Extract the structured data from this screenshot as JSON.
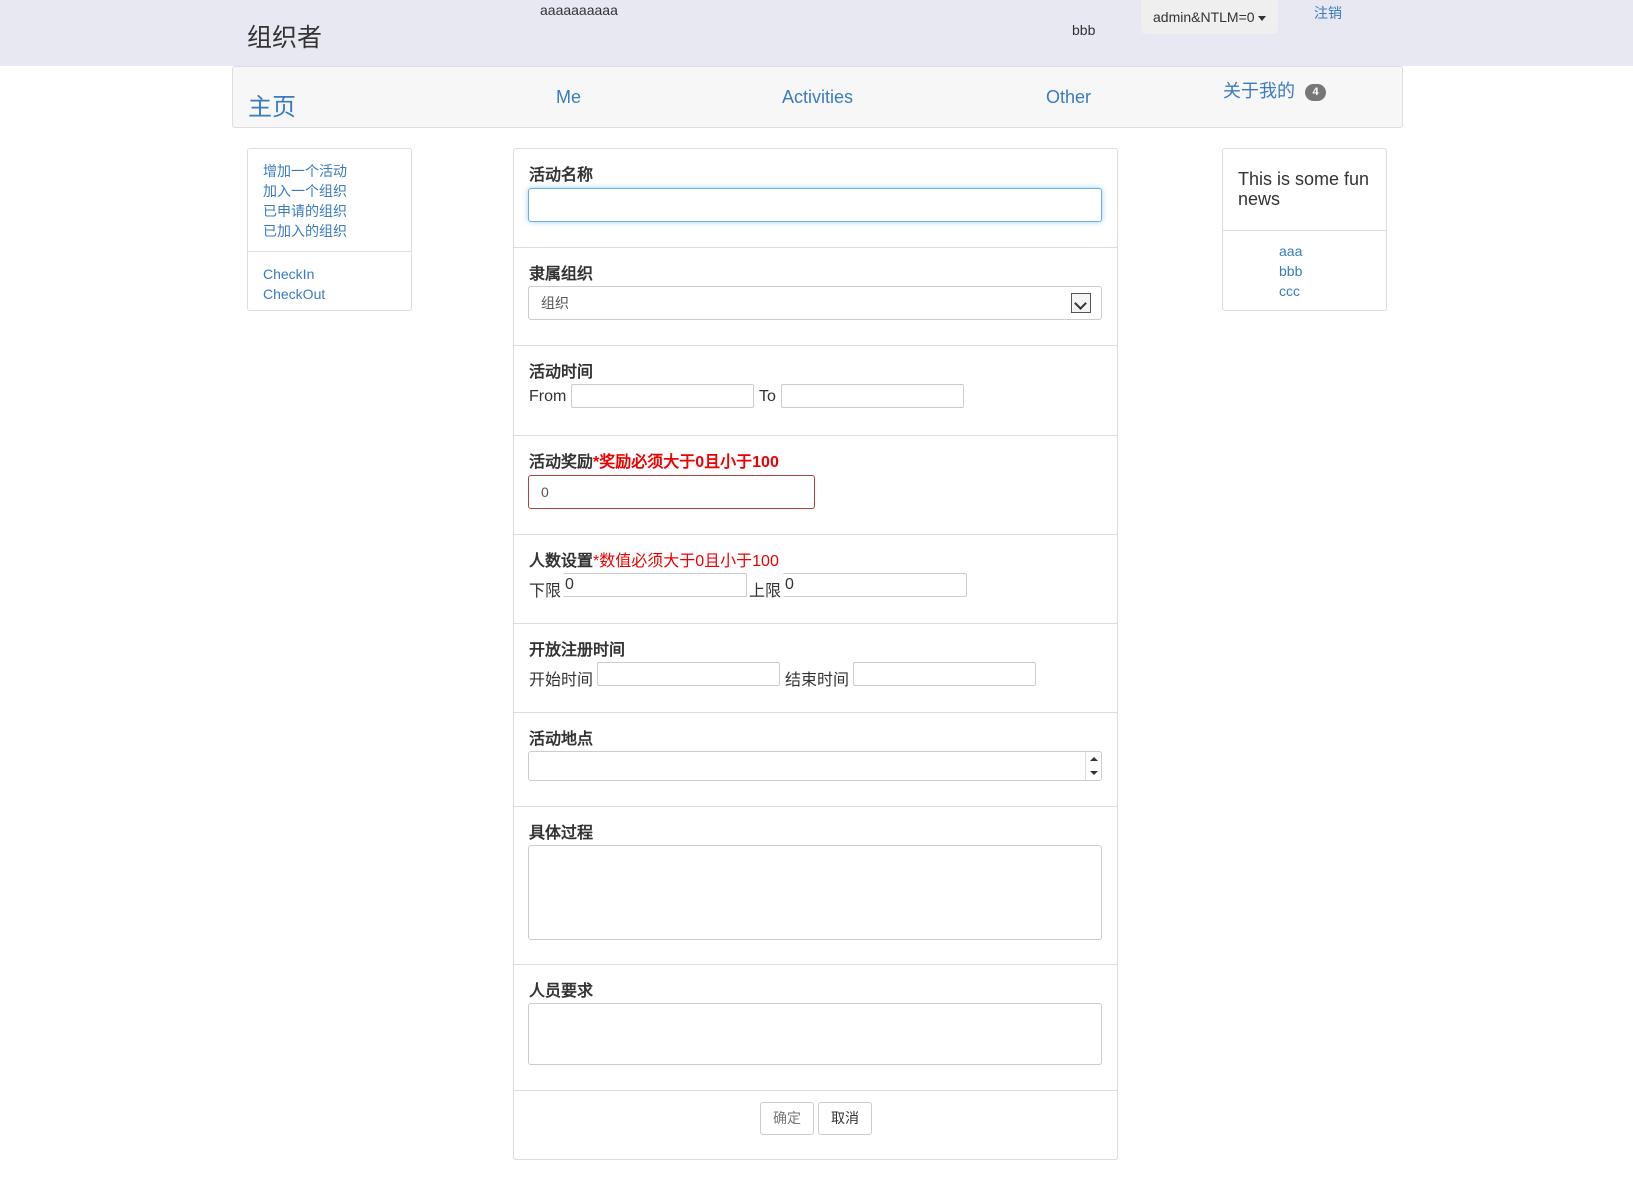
{
  "header": {
    "brand": "组织者",
    "top_text": "aaaaaaaaaa",
    "user_label": "bbb",
    "account_dropdown": "admin&NTLM=0",
    "logout": "注销"
  },
  "nav": {
    "home": "主页",
    "items": [
      "Me",
      "Activities",
      "Other"
    ],
    "about": "关于我的",
    "about_badge": "4"
  },
  "sidebar": {
    "group1": [
      "增加一个活动",
      "加入一个组织",
      "已申请的组织",
      "已加入的组织"
    ],
    "group2": [
      "CheckIn",
      "CheckOut"
    ]
  },
  "news": {
    "title": "This is some fun news",
    "items": [
      "aaa",
      "bbb",
      "ccc"
    ]
  },
  "form": {
    "name": {
      "label": "活动名称",
      "value": ""
    },
    "org": {
      "label": "隶属组织",
      "selected": "组织"
    },
    "time": {
      "label": "活动时间",
      "from_label": "From",
      "to_label": "To",
      "from_value": "",
      "to_value": ""
    },
    "reward": {
      "label": "活动奖励",
      "error": "*奖励必须大于0且小于100",
      "value": "0"
    },
    "people": {
      "label": "人数设置",
      "error": "*数值必须大于0且小于100",
      "min_label": "下限",
      "min_value": "0",
      "max_label": "上限",
      "max_value": "0"
    },
    "register": {
      "label": "开放注册时间",
      "start_label": "开始时间",
      "end_label": "结束时间",
      "start_value": "",
      "end_value": ""
    },
    "location": {
      "label": "活动地点",
      "value": ""
    },
    "process": {
      "label": "具体过程",
      "value": ""
    },
    "requirements": {
      "label": "人员要求",
      "value": ""
    },
    "buttons": {
      "confirm": "确定",
      "cancel": "取消"
    }
  },
  "colors": {
    "link": "#3a7bc0",
    "topbar_bg": "#e8e8f3",
    "error": "#ee0000",
    "focus": "#66afe9"
  }
}
